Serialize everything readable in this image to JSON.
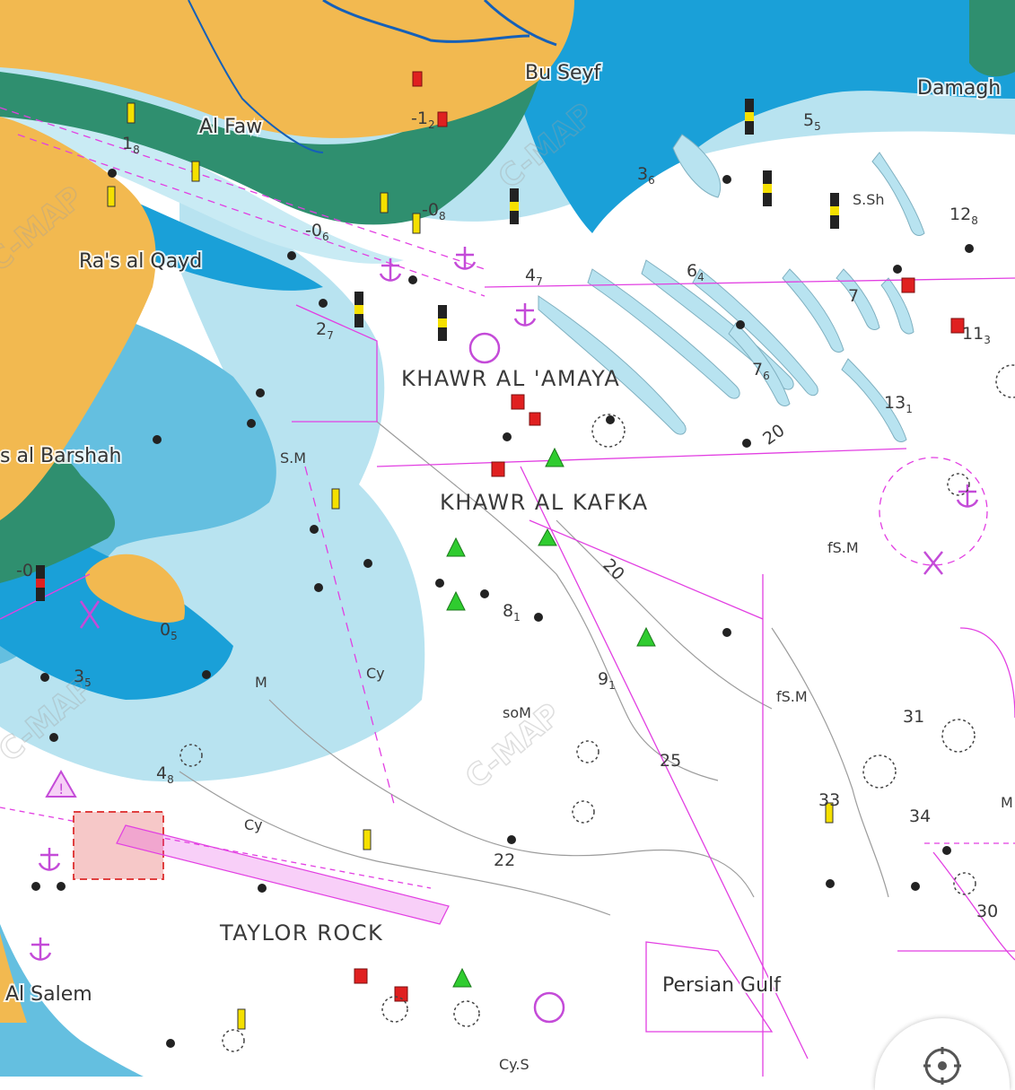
{
  "map": {
    "places": {
      "bu_seyf": "Bu Seyf",
      "damagh": "Damagh",
      "al_faw": "Al Faw",
      "ras_al_qayd": "Ra's al Qayd",
      "ras_al_barshah": "s al Barshah",
      "al_salem": "Al Salem",
      "persian_gulf": "Persian Gulf",
      "taylor_rock": "TAYLOR ROCK",
      "khawr_al_amaya": "KHAWR AL 'AMAYA",
      "khawr_al_kafka": "KHAWR AL KAFKA"
    },
    "seabed": {
      "sm": "S.M",
      "fsm_1": "fS.M",
      "fsm_2": "fS.M",
      "som": "soM",
      "m_1": "M",
      "m_2": "M",
      "cy_1": "Cy",
      "cy_2": "Cy",
      "cys": "Cy.S",
      "ssh": "S.Sh"
    },
    "depths": {
      "d_minus1": {
        "main": "-1",
        "sub": "2"
      },
      "d_1": {
        "main": "1",
        "sub": "8"
      },
      "d_minus0a": {
        "main": "-0",
        "sub": "8"
      },
      "d_minus0b": {
        "main": "-0",
        "sub": "6"
      },
      "d_36": {
        "main": "3",
        "sub": "6"
      },
      "d_55": {
        "main": "5",
        "sub": "5"
      },
      "d_128": {
        "main": "12",
        "sub": "8"
      },
      "d_47": {
        "main": "4",
        "sub": "7"
      },
      "d_64": {
        "main": "6",
        "sub": "4"
      },
      "d_7": {
        "main": "7",
        "sub": ""
      },
      "d_113": {
        "main": "11",
        "sub": "3"
      },
      "d_27": {
        "main": "2",
        "sub": "7"
      },
      "d_76": {
        "main": "7",
        "sub": "6"
      },
      "d_131": {
        "main": "13",
        "sub": "1"
      },
      "d_20a": {
        "main": "20",
        "sub": ""
      },
      "d_20b": {
        "main": "20",
        "sub": ""
      },
      "d_81": {
        "main": "8",
        "sub": "1"
      },
      "d_91": {
        "main": "9",
        "sub": "1"
      },
      "d_0s": {
        "main": "0",
        "sub": "5"
      },
      "d_35": {
        "main": "3",
        "sub": "5"
      },
      "d_48": {
        "main": "4",
        "sub": "8"
      },
      "d_25": {
        "main": "25",
        "sub": ""
      },
      "d_31": {
        "main": "31",
        "sub": ""
      },
      "d_33": {
        "main": "33",
        "sub": ""
      },
      "d_34": {
        "main": "34",
        "sub": ""
      },
      "d_22": {
        "main": "22",
        "sub": ""
      },
      "d_30": {
        "main": "30",
        "sub": ""
      },
      "d_minus0c": {
        "main": "-0",
        "sub": ""
      }
    },
    "watermark": "C-MAP",
    "colors": {
      "land": "#f2b950",
      "intertidal": "#2f8f6f",
      "deep_blue": "#1aa0d8",
      "mid_blue": "#64bfe0",
      "light_blue": "#b8e3f0",
      "deep_water": "#ffffff",
      "nav_line": "#e23fe2"
    },
    "compass_icon": "compass-icon"
  }
}
